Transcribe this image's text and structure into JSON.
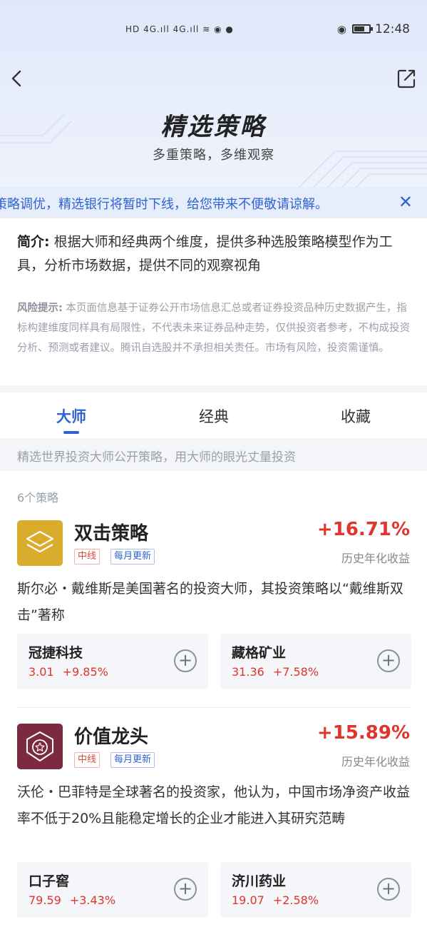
{
  "status_bar": {
    "left_indicators": "HD 4G.ıll 4G.ıll ≋ ◉ ●",
    "time": "12:48"
  },
  "header": {
    "title": "精选策略",
    "subtitle": "多重策略，多维观察"
  },
  "notice": {
    "text": "策略调优，精选银行将暂时下线，给您带来不便敬请谅解。",
    "close_icon": "close-icon"
  },
  "intro": {
    "label": "简介:",
    "text": " 根据大师和经典两个维度，提供多种选股策略模型作为工具，分析市场数据，提供不同的观察视角"
  },
  "risk": {
    "label": "风险提示:",
    "text": " 本页面信息基于证券公开市场信息汇总或者证券投资品种历史数据产生，指标构建维度同样具有局限性，不代表未来证券品种走势，仅供投资者参考，不构成投资分析、预测或者建议。腾讯自选股并不承担相关责任。市场有风险，投资需谨慎。"
  },
  "tabs": [
    {
      "label": "大师",
      "active": true
    },
    {
      "label": "经典",
      "active": false
    },
    {
      "label": "收藏",
      "active": false
    }
  ],
  "tab_desc": "精选世界投资大师公开策略，用大师的眼光丈量投资",
  "strategy_count": "6个策略",
  "strategies": [
    {
      "name": "双击策略",
      "icon": "layers-icon",
      "icon_color": "#d9ad2b",
      "tags": [
        "中线",
        "每月更新"
      ],
      "return": "+16.71%",
      "return_label": "历史年化收益",
      "desc": "斯尔必・戴维斯是美国著名的投资大师，其投资策略以“戴维斯双击”著称",
      "stocks": [
        {
          "name": "冠捷科技",
          "price": "3.01",
          "change": "+9.85%"
        },
        {
          "name": "藏格矿业",
          "price": "31.36",
          "change": "+7.58%"
        }
      ]
    },
    {
      "name": "价值龙头",
      "icon": "star-badge-icon",
      "icon_color": "#7b2a3f",
      "tags": [
        "中线",
        "每月更新"
      ],
      "return": "+15.89%",
      "return_label": "历史年化收益",
      "desc": "沃伦・巴菲特是全球著名的投资家，他认为，中国市场净资产收益率不低于20%且能稳定增长的企业才能进入其研究范畴",
      "stocks": [
        {
          "name": "口子窖",
          "price": "79.59",
          "change": "+3.43%"
        },
        {
          "name": "济川药业",
          "price": "19.07",
          "change": "+2.58%"
        }
      ]
    }
  ],
  "colors": {
    "accent": "#2f63cf",
    "up": "#e0352b"
  }
}
